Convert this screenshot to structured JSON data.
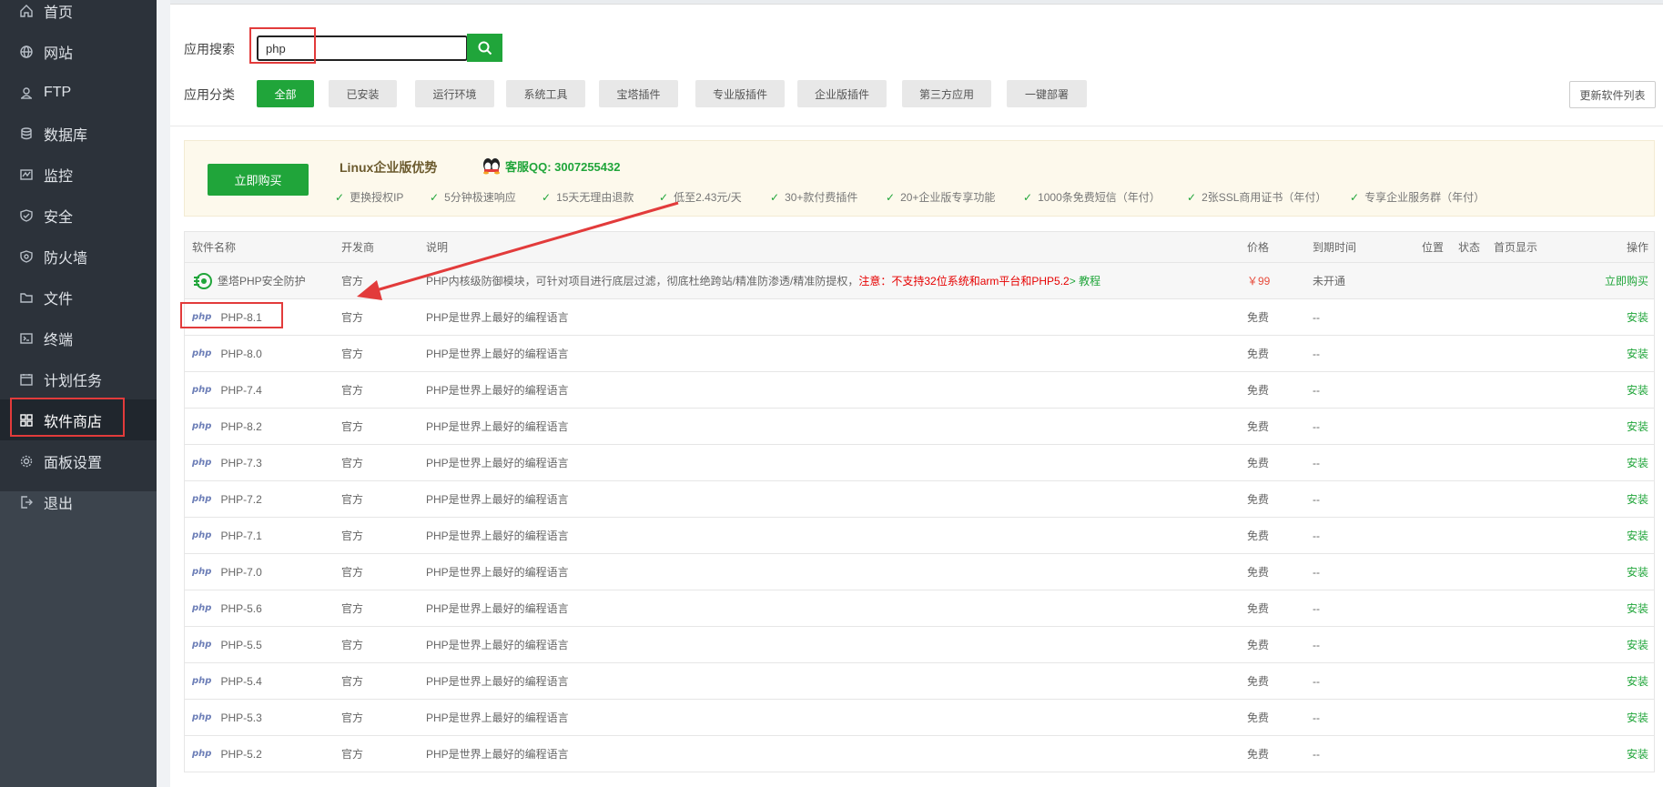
{
  "sidebar": {
    "items": [
      {
        "label": "首页",
        "icon": "home-icon"
      },
      {
        "label": "网站",
        "icon": "globe-icon"
      },
      {
        "label": "FTP",
        "icon": "ftp-icon"
      },
      {
        "label": "数据库",
        "icon": "database-icon"
      },
      {
        "label": "监控",
        "icon": "monitor-icon"
      },
      {
        "label": "安全",
        "icon": "shield-icon"
      },
      {
        "label": "防火墙",
        "icon": "firewall-icon"
      },
      {
        "label": "文件",
        "icon": "folder-icon"
      },
      {
        "label": "终端",
        "icon": "terminal-icon"
      },
      {
        "label": "计划任务",
        "icon": "calendar-icon"
      },
      {
        "label": "软件商店",
        "icon": "grid-icon",
        "active": true
      },
      {
        "label": "面板设置",
        "icon": "gear-icon"
      },
      {
        "label": "退出",
        "icon": "logout-icon"
      }
    ]
  },
  "search": {
    "label": "应用搜索",
    "value": "php"
  },
  "categories": {
    "label": "应用分类",
    "items": [
      "全部",
      "已安装",
      "运行环境",
      "系统工具",
      "宝塔插件",
      "专业版插件",
      "企业版插件",
      "第三方应用",
      "一键部署"
    ],
    "active": "全部"
  },
  "refresh_label": "更新软件列表",
  "promo": {
    "buy_label": "立即购买",
    "title": "Linux企业版优势",
    "qq": "客服QQ: 3007255432",
    "features": [
      "更换授权IP",
      "5分钟极速响应",
      "15天无理由退款",
      "低至2.43元/天",
      "30+款付费插件",
      "20+企业版专享功能",
      "1000条免费短信（年付）",
      "2张SSL商用证书（年付）",
      "专享企业服务群（年付）"
    ]
  },
  "table": {
    "headers": {
      "name": "软件名称",
      "dev": "开发商",
      "desc": "说明",
      "price": "价格",
      "expire": "到期时间",
      "pos": "位置",
      "status": "状态",
      "home": "首页显示",
      "op": "操作"
    },
    "first_row": {
      "name": "堡塔PHP安全防护",
      "dev": "官方",
      "desc": "PHP内核级防御模块，可针对项目进行底层过滤，彻底杜绝跨站/精准防渗透/精准防提权，",
      "warn": "注意：不支持32位系统和arm平台和PHP5.2",
      "tutorial": " > 教程",
      "price": "￥99",
      "expire": "未开通",
      "op": "立即购买"
    },
    "rows": [
      {
        "name": "PHP-8.1",
        "dev": "官方",
        "desc": "PHP是世界上最好的编程语言",
        "price": "免费",
        "expire": "--",
        "op": "安装"
      },
      {
        "name": "PHP-8.0",
        "dev": "官方",
        "desc": "PHP是世界上最好的编程语言",
        "price": "免费",
        "expire": "--",
        "op": "安装"
      },
      {
        "name": "PHP-7.4",
        "dev": "官方",
        "desc": "PHP是世界上最好的编程语言",
        "price": "免费",
        "expire": "--",
        "op": "安装"
      },
      {
        "name": "PHP-8.2",
        "dev": "官方",
        "desc": "PHP是世界上最好的编程语言",
        "price": "免费",
        "expire": "--",
        "op": "安装"
      },
      {
        "name": "PHP-7.3",
        "dev": "官方",
        "desc": "PHP是世界上最好的编程语言",
        "price": "免费",
        "expire": "--",
        "op": "安装"
      },
      {
        "name": "PHP-7.2",
        "dev": "官方",
        "desc": "PHP是世界上最好的编程语言",
        "price": "免费",
        "expire": "--",
        "op": "安装"
      },
      {
        "name": "PHP-7.1",
        "dev": "官方",
        "desc": "PHP是世界上最好的编程语言",
        "price": "免费",
        "expire": "--",
        "op": "安装"
      },
      {
        "name": "PHP-7.0",
        "dev": "官方",
        "desc": "PHP是世界上最好的编程语言",
        "price": "免费",
        "expire": "--",
        "op": "安装"
      },
      {
        "name": "PHP-5.6",
        "dev": "官方",
        "desc": "PHP是世界上最好的编程语言",
        "price": "免费",
        "expire": "--",
        "op": "安装"
      },
      {
        "name": "PHP-5.5",
        "dev": "官方",
        "desc": "PHP是世界上最好的编程语言",
        "price": "免费",
        "expire": "--",
        "op": "安装"
      },
      {
        "name": "PHP-5.4",
        "dev": "官方",
        "desc": "PHP是世界上最好的编程语言",
        "price": "免费",
        "expire": "--",
        "op": "安装"
      },
      {
        "name": "PHP-5.3",
        "dev": "官方",
        "desc": "PHP是世界上最好的编程语言",
        "price": "免费",
        "expire": "--",
        "op": "安装"
      },
      {
        "name": "PHP-5.2",
        "dev": "官方",
        "desc": "PHP是世界上最好的编程语言",
        "price": "免费",
        "expire": "--",
        "op": "安装"
      }
    ],
    "php_logo": "php"
  },
  "colors": {
    "accent": "#20a53a",
    "sidebar": "#3c444d",
    "highlight": "#e23b3b"
  }
}
